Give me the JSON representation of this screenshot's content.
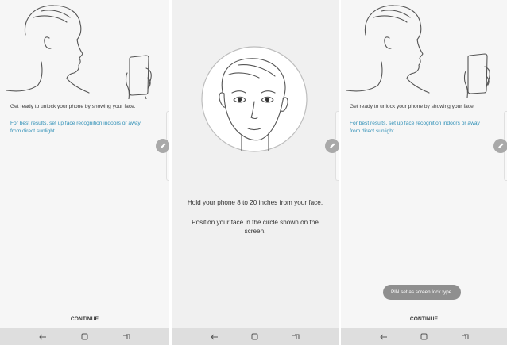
{
  "screens": [
    {
      "message": "Get ready to unlock your phone by showing your face.",
      "tip_line1": "For best results, set up face recognition indoors or away",
      "tip_line2": "from direct sunlight.",
      "continue_label": "CONTINUE"
    },
    {
      "instruction": "Hold your phone 8 to 20 inches from your face.",
      "position_line1": "Position your face in the circle shown on the",
      "position_line2": "screen."
    },
    {
      "message": "Get ready to unlock your phone by showing your face.",
      "tip_line1": "For best results, set up face recognition indoors or away",
      "tip_line2": "from direct sunlight.",
      "continue_label": "CONTINUE",
      "toast": "PIN set as screen lock type."
    }
  ],
  "icons": {
    "back": "back-arrow-icon",
    "home": "home-square-icon",
    "recents": "recents-icon",
    "edge": "pencil-icon"
  },
  "colors": {
    "tip_text": "#2e8fb6",
    "nav_bar": "#dedede",
    "edge_handle": "#a9a9a9",
    "toast_bg": "#8f8f8f"
  }
}
